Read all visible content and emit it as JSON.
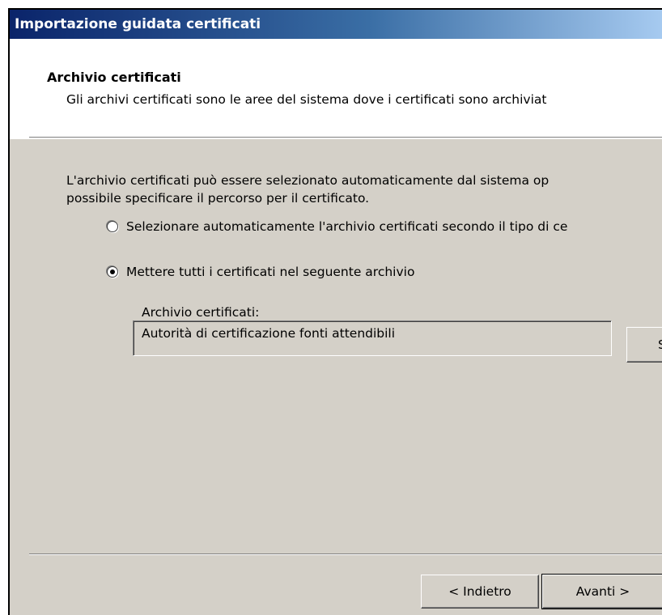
{
  "window": {
    "title": "Importazione guidata certificati"
  },
  "header": {
    "title": "Archivio certificati",
    "subtitle": "Gli archivi certificati sono le aree del sistema dove i certificati sono archiviat"
  },
  "body": {
    "intro_line1": "L'archivio certificati può essere selezionato automaticamente dal sistema op",
    "intro_line2": "possibile specificare il percorso per il certificato.",
    "options": [
      {
        "label": "Selezionare automaticamente l'archivio certificati secondo il tipo di ce",
        "checked": false
      },
      {
        "label": "Mettere tutti i certificati nel seguente archivio",
        "checked": true
      }
    ],
    "store_label": "Archivio certificati:",
    "store_value": "Autorità di certificazione fonti attendibili",
    "browse_label": "S"
  },
  "footer": {
    "back_label": "< Indietro",
    "next_label": "Avanti >"
  }
}
